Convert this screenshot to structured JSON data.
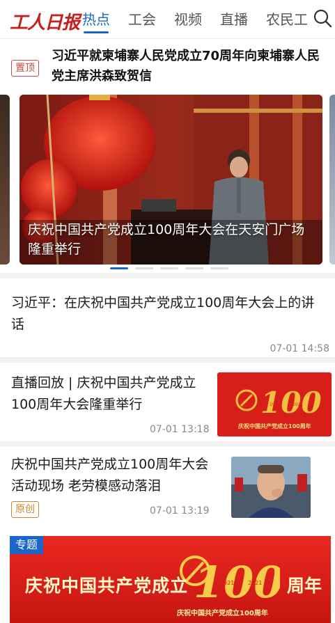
{
  "header": {
    "logo_text": "工人日报",
    "tabs": [
      "热点",
      "工会",
      "视频",
      "直播",
      "农民工"
    ],
    "active_tab": "热点",
    "search_icon": "search-icon"
  },
  "pinned": {
    "badge": "置顶",
    "title": "习近平就柬埔寨人民党成立70周年向柬埔寨人民党主席洪森致贺信"
  },
  "carousel": {
    "caption": "庆祝中国共产党成立100周年大会在天安门广场隆重举行",
    "slide_count": 5,
    "active_index": 0
  },
  "articles": [
    {
      "title": "习近平：在庆祝中国共产党成立100周年大会上的讲话",
      "time": "07-01 14:58"
    },
    {
      "title": "直播回放 | 庆祝中国共产党成立100周年大会隆重举行",
      "time": "07-01 13:18",
      "thumb_text": "100",
      "thumb_years": [
        "1921",
        "2021"
      ],
      "thumb_caption": "庆祝中国共产党成立100周年"
    },
    {
      "title": "庆祝中国共产党成立100周年大会活动现场 老劳模感动落泪",
      "time": "07-01 13:19",
      "badge": "原创"
    }
  ],
  "feature": {
    "tag": "专题",
    "text_left": "庆祝中国共产党成立",
    "number": "100",
    "text_right": "周年",
    "years": [
      "1921",
      "2021"
    ],
    "sub": "庆祝中国共产党成立100周年"
  },
  "colors": {
    "accent": "#1a66c9",
    "brand_red": "#c81e1e",
    "badge_red": "#c84a3a",
    "badge_orange": "#d4822a"
  }
}
